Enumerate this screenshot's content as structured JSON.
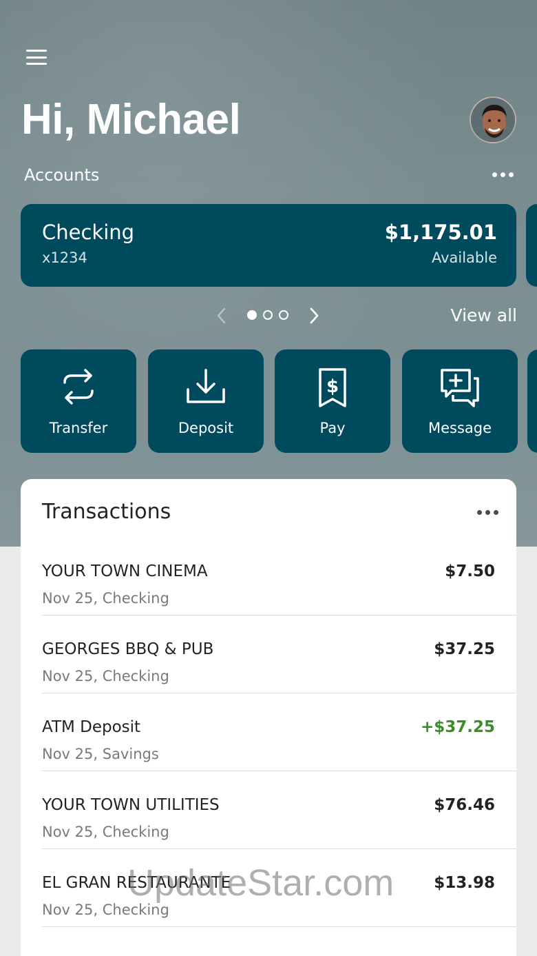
{
  "header": {
    "greeting": "Hi, Michael",
    "accounts_label": "Accounts"
  },
  "account": {
    "name": "Checking",
    "number": "x1234",
    "balance": "$1,175.01",
    "balance_caption": "Available"
  },
  "carousel": {
    "pages": 3,
    "active_page": 1,
    "view_all": "View all"
  },
  "actions": [
    {
      "label": "Transfer",
      "icon": "transfer-icon"
    },
    {
      "label": "Deposit",
      "icon": "deposit-icon"
    },
    {
      "label": "Pay",
      "icon": "pay-bill-icon"
    },
    {
      "label": "Message",
      "icon": "message-icon"
    }
  ],
  "transactions": {
    "title": "Transactions",
    "items": [
      {
        "merchant": "YOUR TOWN CINEMA",
        "detail": "Nov 25, Checking",
        "amount": "$7.50",
        "credit": false
      },
      {
        "merchant": "GEORGES BBQ & PUB",
        "detail": "Nov 25, Checking",
        "amount": "$37.25",
        "credit": false
      },
      {
        "merchant": "ATM Deposit",
        "detail": "Nov 25, Savings",
        "amount": "+$37.25",
        "credit": true
      },
      {
        "merchant": "YOUR TOWN UTILITIES",
        "detail": "Nov 25, Checking",
        "amount": "$76.46",
        "credit": false
      },
      {
        "merchant": "EL GRAN RESTAURANTE",
        "detail": "Nov 25, Checking",
        "amount": "$13.98",
        "credit": false
      }
    ]
  },
  "watermark": "UpdateStar.com",
  "colors": {
    "brand": "#004a5e",
    "credit": "#3a8d27",
    "text": "#1f2326",
    "muted": "#747a7e"
  }
}
